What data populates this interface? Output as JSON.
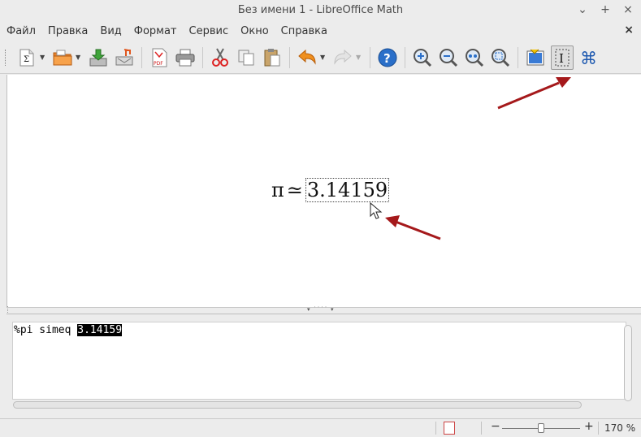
{
  "window": {
    "title": "Без имени 1 - LibreOffice Math",
    "controls": [
      "⌄",
      "+",
      "×"
    ]
  },
  "menu": {
    "items": [
      "Файл",
      "Правка",
      "Вид",
      "Формат",
      "Сервис",
      "Окно",
      "Справка"
    ],
    "close": "×"
  },
  "toolbar": {
    "icons": [
      "new-formula-icon",
      "open-icon",
      "save-icon",
      "export-icon",
      "pdf-icon",
      "print-icon",
      "cut-icon",
      "copy-icon",
      "paste-icon",
      "undo-icon",
      "redo-icon",
      "help-icon",
      "zoom-in-icon",
      "zoom-out-icon",
      "zoom-100-icon",
      "show-all-icon",
      "update-icon",
      "formula-cursor-icon",
      "symbols-icon"
    ],
    "pdf_label": "PDF",
    "sigma": "Σ",
    "help": "?",
    "cursor": "I",
    "symbols": "⌘"
  },
  "preview": {
    "pi": "π",
    "simeq": "≃",
    "number": "3.14159"
  },
  "command": {
    "text_before": "%pi simeq ",
    "selected": "3.14159"
  },
  "status": {
    "zoom_minus": "−",
    "zoom_plus": "+",
    "zoom_value": "170 %",
    "zoom_fraction": 0.5
  },
  "colors": {
    "arrow": "#a5191b",
    "accent_blue": "#2a6fc9",
    "selection": "#000000"
  }
}
